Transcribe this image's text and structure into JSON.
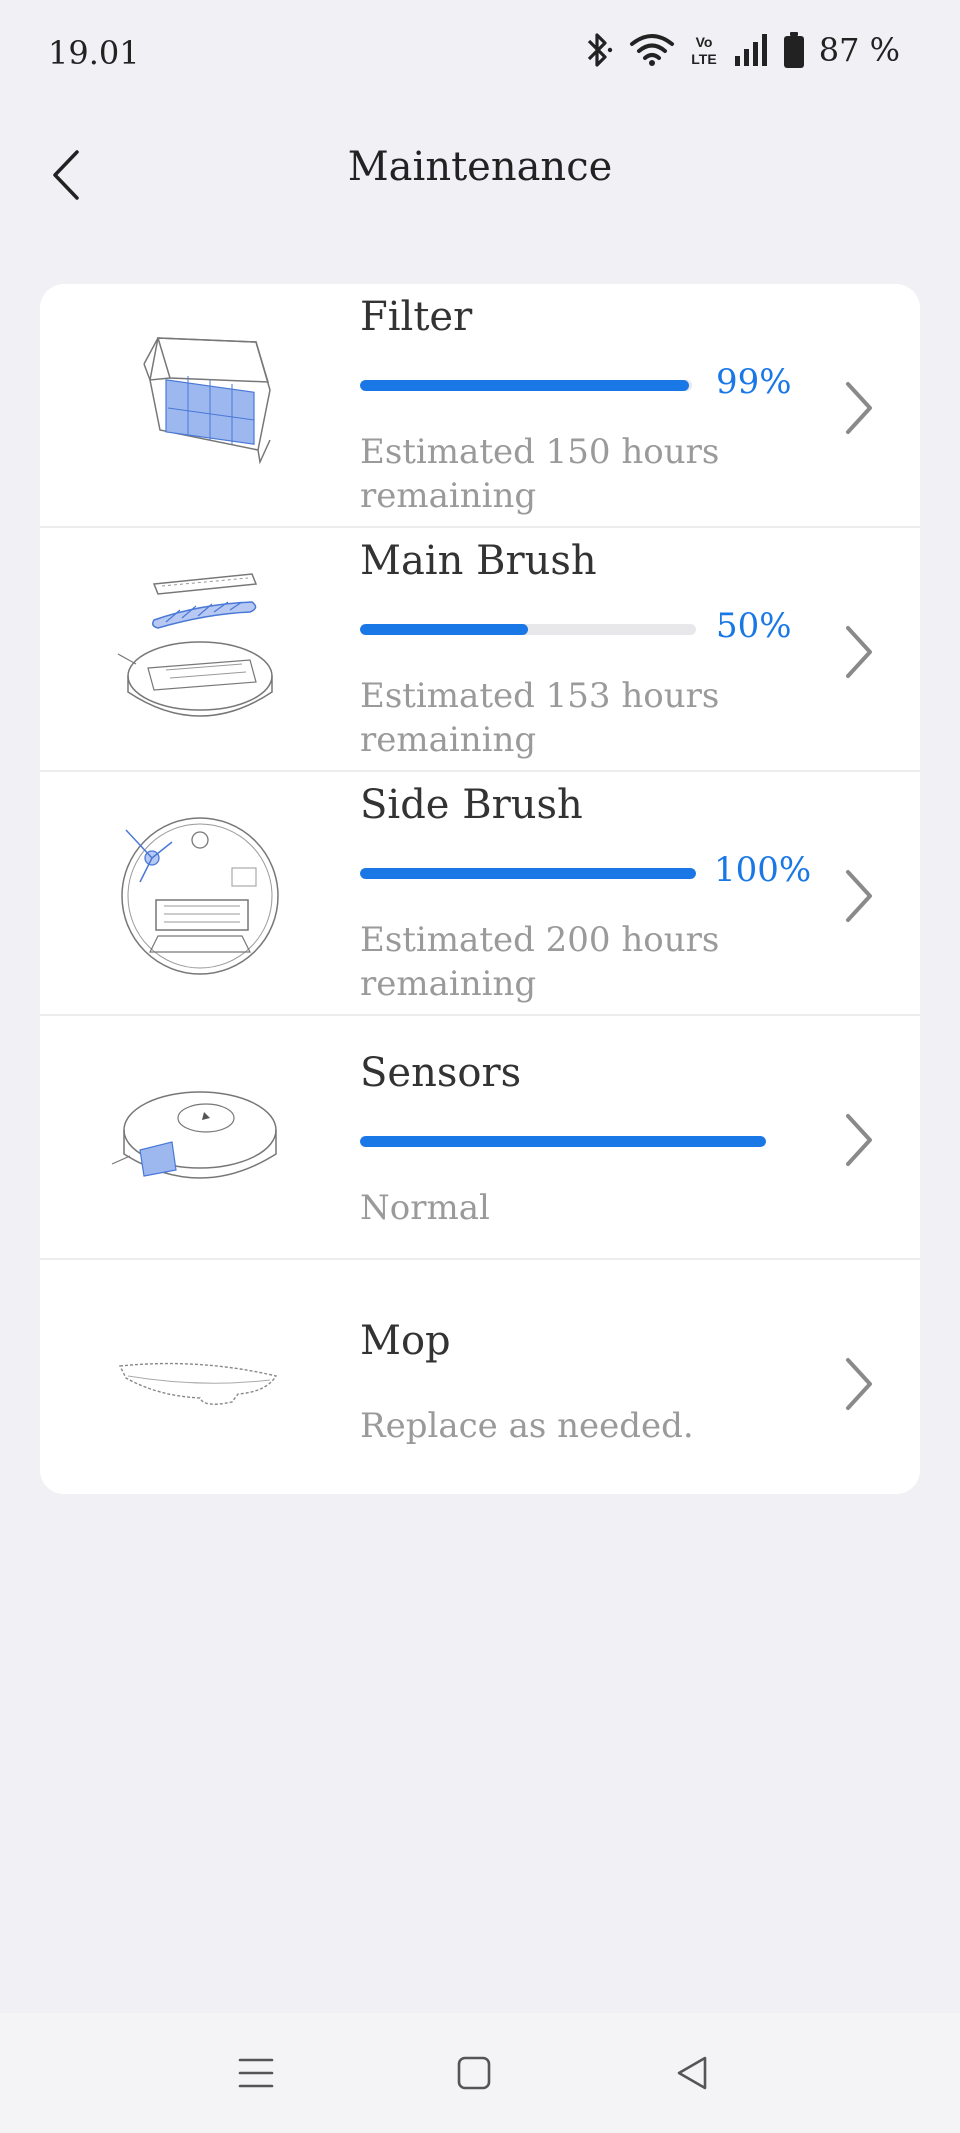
{
  "status_bar": {
    "time": "19.01",
    "battery": "87 %",
    "icons": [
      "bluetooth-icon",
      "wifi-icon",
      "volte-icon",
      "signal-icon",
      "battery-icon"
    ]
  },
  "header": {
    "title": "Maintenance",
    "back_icon": "chevron-left-icon"
  },
  "items": [
    {
      "title": "Filter",
      "progress": 0.99,
      "percent": "99%",
      "subtitle": "Estimated 150 hours remaining",
      "image": "filter-image"
    },
    {
      "title": "Main Brush",
      "progress": 0.5,
      "percent": "50%",
      "subtitle": "Estimated 153 hours remaining",
      "image": "main-brush-image"
    },
    {
      "title": "Side Brush",
      "progress": 1.0,
      "percent": "100%",
      "subtitle": "Estimated 200 hours remaining",
      "image": "side-brush-image"
    },
    {
      "title": "Sensors",
      "progress": 1.0,
      "subtitle": "Normal",
      "image": "sensors-image"
    },
    {
      "title": "Mop",
      "subtitle": "Replace as needed.",
      "image": "mop-image"
    }
  ],
  "colors": {
    "accent": "#1a78e6",
    "background": "#f1f1f5",
    "card": "#ffffff",
    "muted_text": "#9a9a9a"
  },
  "nav": {
    "icons": [
      "menu-icon",
      "home-icon",
      "back-icon"
    ]
  }
}
